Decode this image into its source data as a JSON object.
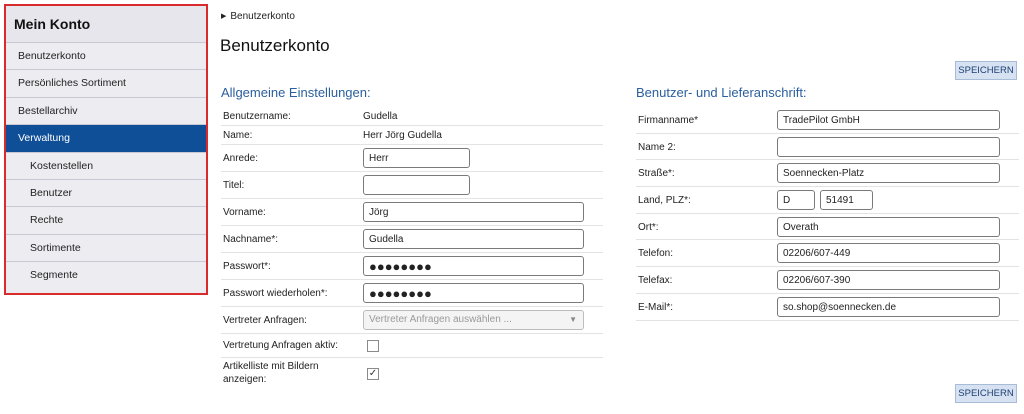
{
  "sidebar": {
    "title": "Mein Konto",
    "items": [
      {
        "label": "Benutzerkonto"
      },
      {
        "label": "Persönliches Sortiment"
      },
      {
        "label": "Bestellarchiv"
      },
      {
        "label": "Verwaltung"
      },
      {
        "label": "Kostenstellen"
      },
      {
        "label": "Benutzer"
      },
      {
        "label": "Rechte"
      },
      {
        "label": "Sortimente"
      },
      {
        "label": "Segmente"
      }
    ],
    "active_item": "Verwaltung"
  },
  "breadcrumb": {
    "label": "Benutzerkonto"
  },
  "page_title": "Benutzerkonto",
  "buttons": {
    "save_top": "SPEICHERN",
    "save_bottom": "SPEICHERN"
  },
  "general": {
    "title": "Allgemeine Einstellungen:",
    "username_label": "Benutzername:",
    "username_value": "Gudella",
    "name_label": "Name:",
    "name_value": "Herr Jörg Gudella",
    "salutation_label": "Anrede:",
    "salutation_value": "Herr",
    "title_label": "Titel:",
    "title_value": "",
    "firstname_label": "Vorname:",
    "firstname_value": "Jörg",
    "lastname_label": "Nachname*:",
    "lastname_value": "Gudella",
    "password_label": "Passwort*:",
    "password_value": "●●●●●●●●",
    "password_repeat_label": "Passwort wiederholen*:",
    "password_repeat_value": "●●●●●●●●",
    "rep_requests_label": "Vertreter Anfragen:",
    "rep_requests_placeholder": "Vertreter Anfragen auswählen ...",
    "rep_active_label": "Vertretung Anfragen aktiv:",
    "rep_active_checked": false,
    "images_label_1": "Artikelliste mit Bildern",
    "images_label_2": "anzeigen:",
    "images_checked": true
  },
  "address": {
    "title": "Benutzer- und Lieferanschrift:",
    "company_label": "Firmanname*",
    "company_value": "TradePilot GmbH",
    "name2_label": "Name 2:",
    "name2_value": "",
    "street_label": "Straße*:",
    "street_value": "Soennecken-Platz",
    "country_label": "Land, PLZ*:",
    "country_value": "D",
    "zip_value": "51491",
    "city_label": "Ort*:",
    "city_value": "Overath",
    "phone_label": "Telefon:",
    "phone_value": "02206/607-449",
    "fax_label": "Telefax:",
    "fax_value": "02206/607-390",
    "email_label": "E-Mail*:",
    "email_value": "so.shop@soennecken.de"
  },
  "icons": {
    "breadcrumb": "triangle-right-icon",
    "select_arrow": "chevron-down-icon",
    "checkbox": "checkmark-icon"
  },
  "colors": {
    "accent": "#0f4f98",
    "section_title": "#2a5f9e",
    "sidebar_border": "#d92b2b",
    "button_bg": "#d6e2f2"
  }
}
